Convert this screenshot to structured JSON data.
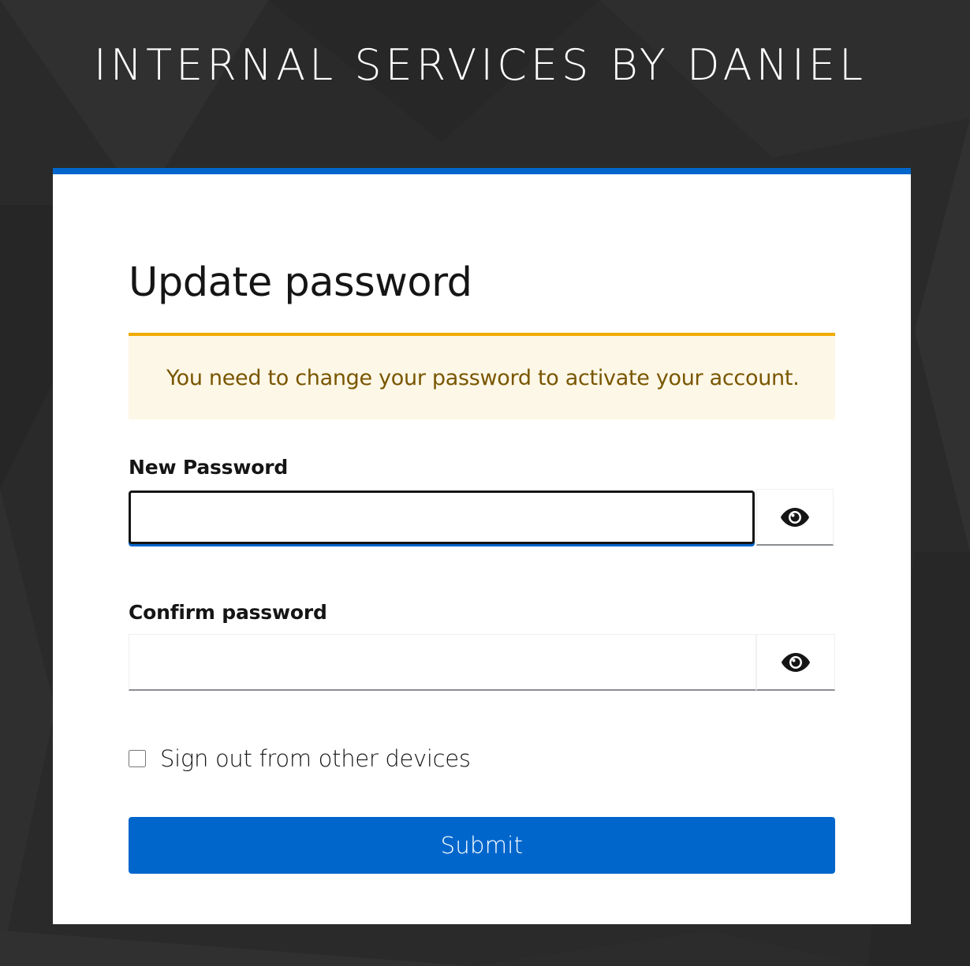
{
  "header": {
    "realm_title": "INTERNAL SERVICES BY DANIEL"
  },
  "card": {
    "title": "Update password",
    "alert": {
      "type": "warning",
      "message": "You need to change your password to activate your account."
    },
    "fields": {
      "new_password": {
        "label": "New Password",
        "value": "",
        "focused": true,
        "toggle_icon": "eye-icon"
      },
      "confirm_password": {
        "label": "Confirm password",
        "value": "",
        "focused": false,
        "toggle_icon": "eye-icon"
      }
    },
    "checkbox": {
      "label": "Sign out from other devices",
      "checked": false
    },
    "submit_label": "Submit"
  },
  "colors": {
    "background": "#2b2b2b",
    "accent": "#0066cc",
    "warning_border": "#f0ab00",
    "warning_background": "#fdf7e7",
    "warning_text": "#795600"
  }
}
